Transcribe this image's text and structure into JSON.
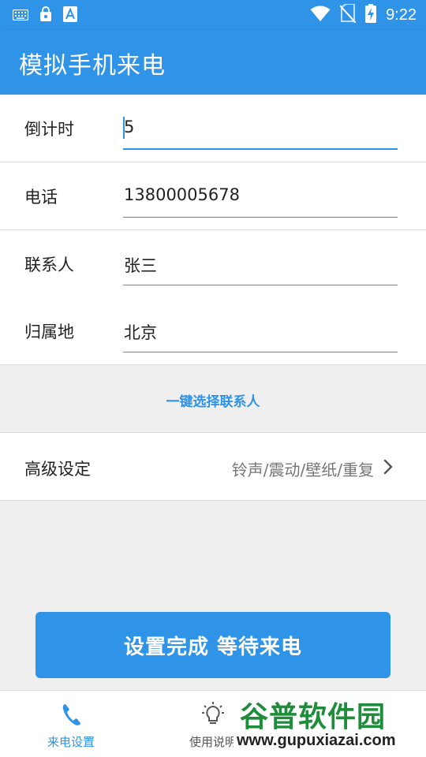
{
  "status_bar": {
    "time": "9:22",
    "left_icons": [
      "keyboard-icon",
      "lock-app-icon",
      "font-app-icon"
    ],
    "right_icons": [
      "wifi-icon",
      "no-sim-icon",
      "battery-charging-icon"
    ]
  },
  "app_bar": {
    "title": "模拟手机来电"
  },
  "form": {
    "countdown": {
      "label": "倒计时",
      "value": "5"
    },
    "phone": {
      "label": "电话",
      "value": "13800005678"
    },
    "contact": {
      "label": "联系人",
      "value": "张三"
    },
    "location": {
      "label": "归属地",
      "value": "北京"
    }
  },
  "pick_contact": {
    "label": "一键选择联系人"
  },
  "advanced": {
    "label": "高级设定",
    "summary": "铃声/震动/壁纸/重复"
  },
  "main_button": {
    "label": "设置完成 等待来电"
  },
  "bottom_nav": {
    "items": [
      {
        "label": "来电设置",
        "icon": "phone-icon",
        "active": true
      },
      {
        "label": "使用说明",
        "icon": "lightbulb-icon",
        "active": false
      }
    ]
  },
  "watermark": {
    "title": "谷普软件园",
    "url": "www.gupuxiazai.com"
  },
  "colors": {
    "primary": "#2f93e8",
    "background": "#efefef",
    "text": "#222222",
    "muted": "#757575"
  }
}
